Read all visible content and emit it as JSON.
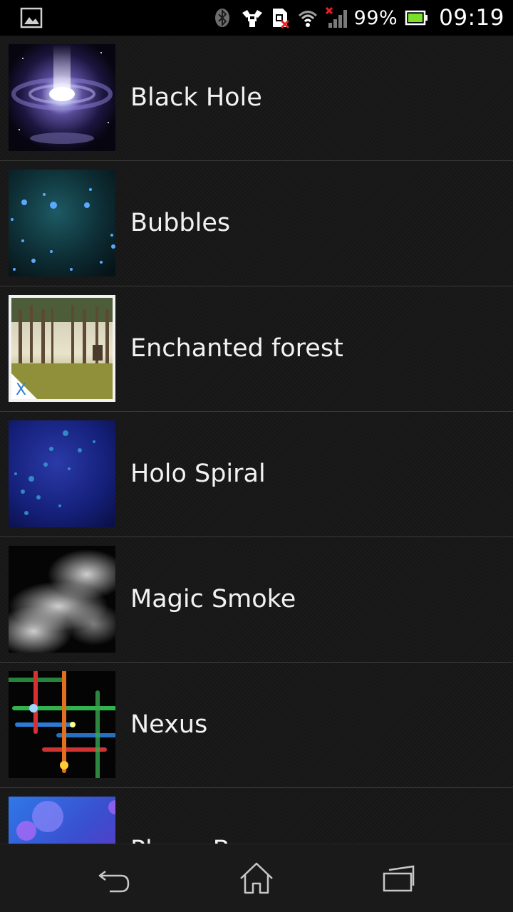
{
  "status_bar": {
    "battery_percent": "99%",
    "time": "09:19",
    "icons": [
      "image-notification-icon",
      "bluetooth-icon",
      "usb-debugging-icon",
      "sim-missing-icon",
      "wifi-icon",
      "signal-no-service-icon",
      "battery-icon"
    ]
  },
  "wallpapers": [
    {
      "label": "Black Hole",
      "thumb": "black-hole"
    },
    {
      "label": "Bubbles",
      "thumb": "bubbles"
    },
    {
      "label": "Enchanted forest",
      "thumb": "enchanted-forest"
    },
    {
      "label": "Holo Spiral",
      "thumb": "holo-spiral"
    },
    {
      "label": "Magic Smoke",
      "thumb": "magic-smoke"
    },
    {
      "label": "Nexus",
      "thumb": "nexus"
    },
    {
      "label": "Phase Beam",
      "thumb": "phase-beam"
    }
  ],
  "nav_bar": {
    "buttons": [
      "back-icon",
      "home-icon",
      "recent-apps-icon"
    ]
  }
}
